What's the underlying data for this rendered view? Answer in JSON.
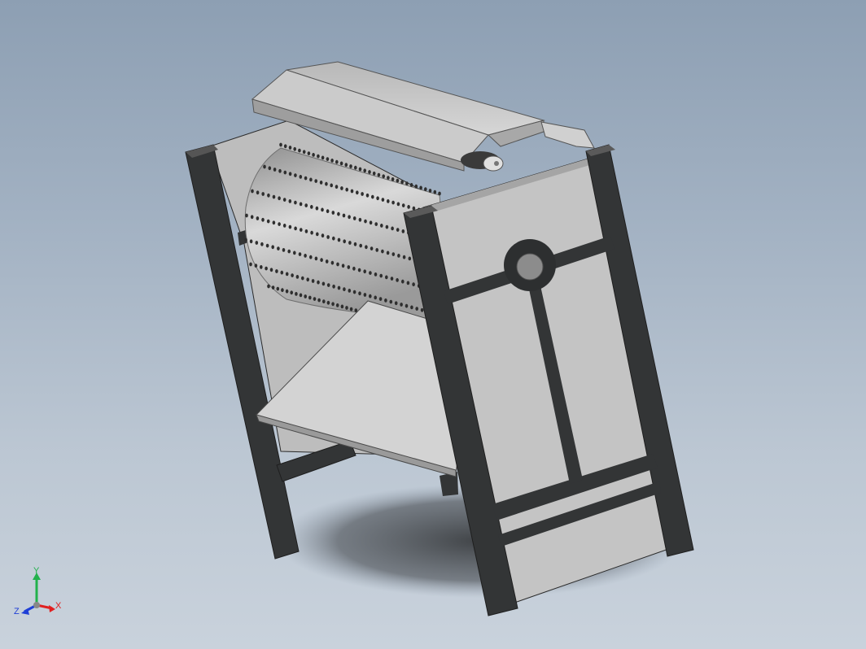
{
  "viewport": {
    "background_top": "#8d9fb3",
    "background_bottom": "#c9d2dc"
  },
  "model": {
    "frame_color": "#333536",
    "panel_color": "#c4c4c4",
    "drum_color": "#a6a6a6",
    "hood_color": "#cfcfcf",
    "tray_color": "#d4d4d4"
  },
  "triad": {
    "y_label": "Y",
    "x_label": "X",
    "z_label": "Z",
    "y_color": "#22b14c",
    "x_color": "#e02020",
    "z_color": "#1f3fd6"
  }
}
